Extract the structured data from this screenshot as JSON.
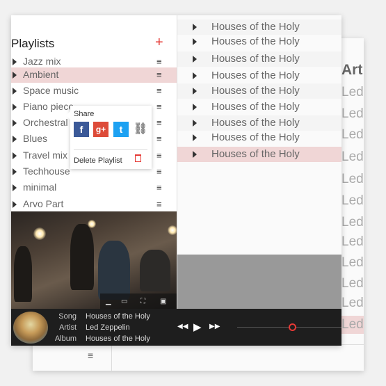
{
  "back_window": {
    "column_header": "Art",
    "cells": [
      "Led",
      "Led",
      "Led",
      "Led",
      "Led",
      "Led",
      "Led",
      "Led",
      "Led",
      "Led",
      "Led",
      "Led"
    ],
    "highlight_index": 11
  },
  "playlists": {
    "title": "Playlists",
    "add_symbol": "+",
    "items": [
      {
        "label": "Jazz mix"
      },
      {
        "label": "Ambient"
      },
      {
        "label": "Space music"
      },
      {
        "label": "Piano piece"
      },
      {
        "label": "Orchestral"
      },
      {
        "label": "Blues"
      },
      {
        "label": "Travel mix"
      },
      {
        "label": "Techhouse"
      },
      {
        "label": "minimal"
      },
      {
        "label": "Arvo Part"
      }
    ],
    "selected_index": 1,
    "menu_symbol": "≡"
  },
  "context_menu": {
    "share_label": "Share",
    "facebook": "f",
    "googleplus": "g+",
    "twitter": "t",
    "link": "🔗",
    "delete_label": "Delete Playlist"
  },
  "tracks": {
    "items": [
      "Houses of the Holy",
      "Houses of the Holy",
      "Houses of the Holy",
      "Houses of the Holy",
      "Houses of the Holy",
      "Houses of the Holy",
      "Houses of the Holy",
      "Houses of the Holy",
      "Houses of the Holy"
    ],
    "selected_index": 8
  },
  "now_playing": {
    "song_key": "Song",
    "artist_key": "Artist",
    "album_key": "Album",
    "song": "Houses of the Holy",
    "artist": "Led Zeppelin",
    "album": "Houses of the Holy",
    "progress": 0.49
  },
  "controls": {
    "prev": "◀◀",
    "play": "▶",
    "next": "▶▶"
  },
  "colors": {
    "accent": "#e53935",
    "selection": "#f0d6d6",
    "player_bg": "#1e1e1e"
  }
}
